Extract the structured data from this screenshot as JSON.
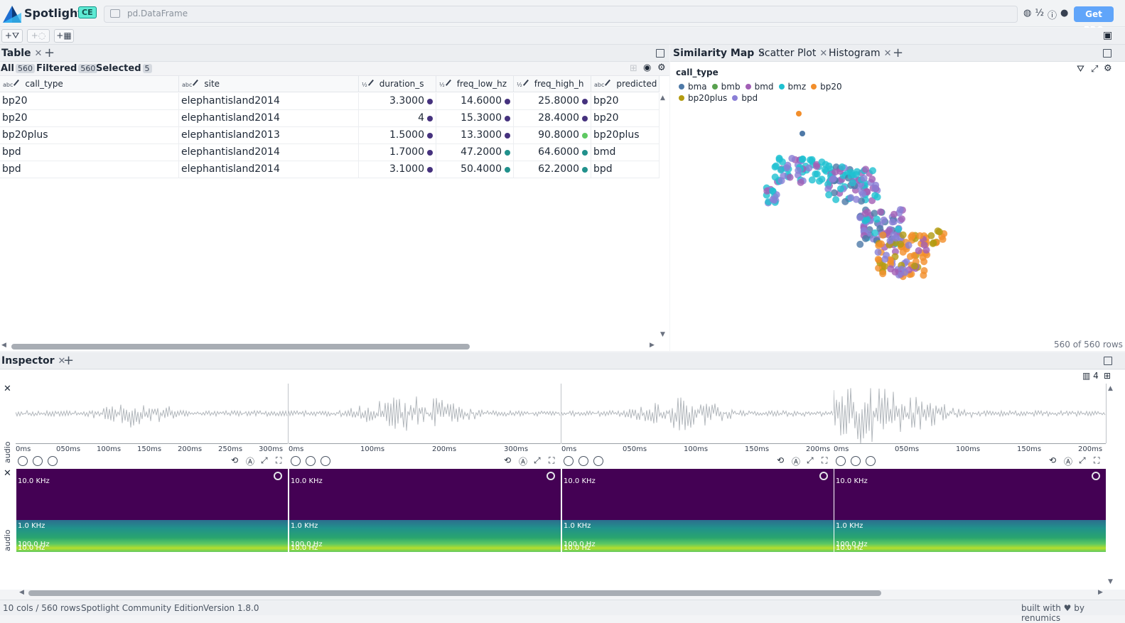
{
  "header": {
    "app_title": "Spotlight",
    "edition_badge": "CE",
    "breadcrumb": "pd.DataFrame",
    "get_pro_label": "Get PRO"
  },
  "toolbar": {
    "add_filter_label": "+",
    "add_similar_label": "+",
    "add_grid_label": "+"
  },
  "table_panel": {
    "tab_label": "Table",
    "filters": {
      "all_label": "All",
      "all_count": "560",
      "filtered_label": "Filtered",
      "filtered_count": "560",
      "selected_label": "Selected",
      "selected_count": "5"
    },
    "columns": [
      {
        "type": "abc",
        "name": "call_type"
      },
      {
        "type": "1/2 3",
        "name": "site"
      },
      {
        "type": "1/2 3",
        "name": "duration_s"
      },
      {
        "type": "1/2 3",
        "name": "freq_low_hz"
      },
      {
        "type": "1/2 3",
        "name": "freq_high_h"
      },
      {
        "type": "abc",
        "name": "predicted"
      }
    ],
    "rows": [
      {
        "call_type": "bp20",
        "site": "elephantisland2014",
        "duration_s": "3.3000",
        "freq_low_hz": "14.6000",
        "freq_high_hz": "25.8000",
        "predicted": "bp20",
        "dot_duration": "#46327e",
        "dot_low": "#46327e",
        "dot_high": "#46327e"
      },
      {
        "call_type": "bp20",
        "site": "elephantisland2014",
        "duration_s": "4",
        "freq_low_hz": "15.3000",
        "freq_high_hz": "28.4000",
        "predicted": "bp20",
        "dot_duration": "#46327e",
        "dot_low": "#46327e",
        "dot_high": "#46327e"
      },
      {
        "call_type": "bp20plus",
        "site": "elephantisland2013",
        "duration_s": "1.5000",
        "freq_low_hz": "13.3000",
        "freq_high_hz": "90.8000",
        "predicted": "bp20plus",
        "dot_duration": "#46327e",
        "dot_low": "#46327e",
        "dot_high": "#5ec962"
      },
      {
        "call_type": "bpd",
        "site": "elephantisland2014",
        "duration_s": "1.7000",
        "freq_low_hz": "47.2000",
        "freq_high_hz": "64.6000",
        "predicted": "bmd",
        "dot_duration": "#46327e",
        "dot_low": "#21918c",
        "dot_high": "#21918c"
      },
      {
        "call_type": "bpd",
        "site": "elephantisland2014",
        "duration_s": "3.1000",
        "freq_low_hz": "50.4000",
        "freq_high_hz": "62.2000",
        "predicted": "bpd",
        "dot_duration": "#46327e",
        "dot_low": "#21918c",
        "dot_high": "#21918c"
      }
    ]
  },
  "viz_panel": {
    "tabs": [
      {
        "label": "Similarity Map"
      },
      {
        "label": "Scatter Plot"
      },
      {
        "label": "Histogram"
      }
    ],
    "legend_title": "call_type",
    "legend": [
      {
        "label": "bma",
        "color": "#4e79a7"
      },
      {
        "label": "bmb",
        "color": "#59a14f"
      },
      {
        "label": "bmd",
        "color": "#a25fb5"
      },
      {
        "label": "bmz",
        "color": "#1fc1d1"
      },
      {
        "label": "bp20",
        "color": "#f28e2b"
      },
      {
        "label": "bp20plus",
        "color": "#b39b10"
      },
      {
        "label": "bpd",
        "color": "#8a7fd6"
      }
    ],
    "rows_count": "560 of 560 rows"
  },
  "inspector": {
    "tab_label": "Inspector",
    "columns_count": "4",
    "audio_label": "audio",
    "axes": [
      [
        "0ms",
        "050ms",
        "100ms",
        "150ms",
        "200ms",
        "250ms",
        "300ms"
      ],
      [
        "0ms",
        "100ms",
        "200ms",
        "300ms"
      ],
      [
        "0ms",
        "050ms",
        "100ms",
        "150ms",
        "200ms"
      ],
      [
        "0ms",
        "050ms",
        "100ms",
        "150ms",
        "200ms"
      ]
    ],
    "spec_labels": [
      "10.0 KHz",
      "1.0 KHz",
      "100.0 Hz",
      "10.0 Hz"
    ]
  },
  "status": {
    "cols_rows": "10 cols / 560 rows",
    "edition": "Spotlight Community Edition",
    "version": "Version 1.8.0",
    "built_with": "built with ♥ by renumics"
  }
}
